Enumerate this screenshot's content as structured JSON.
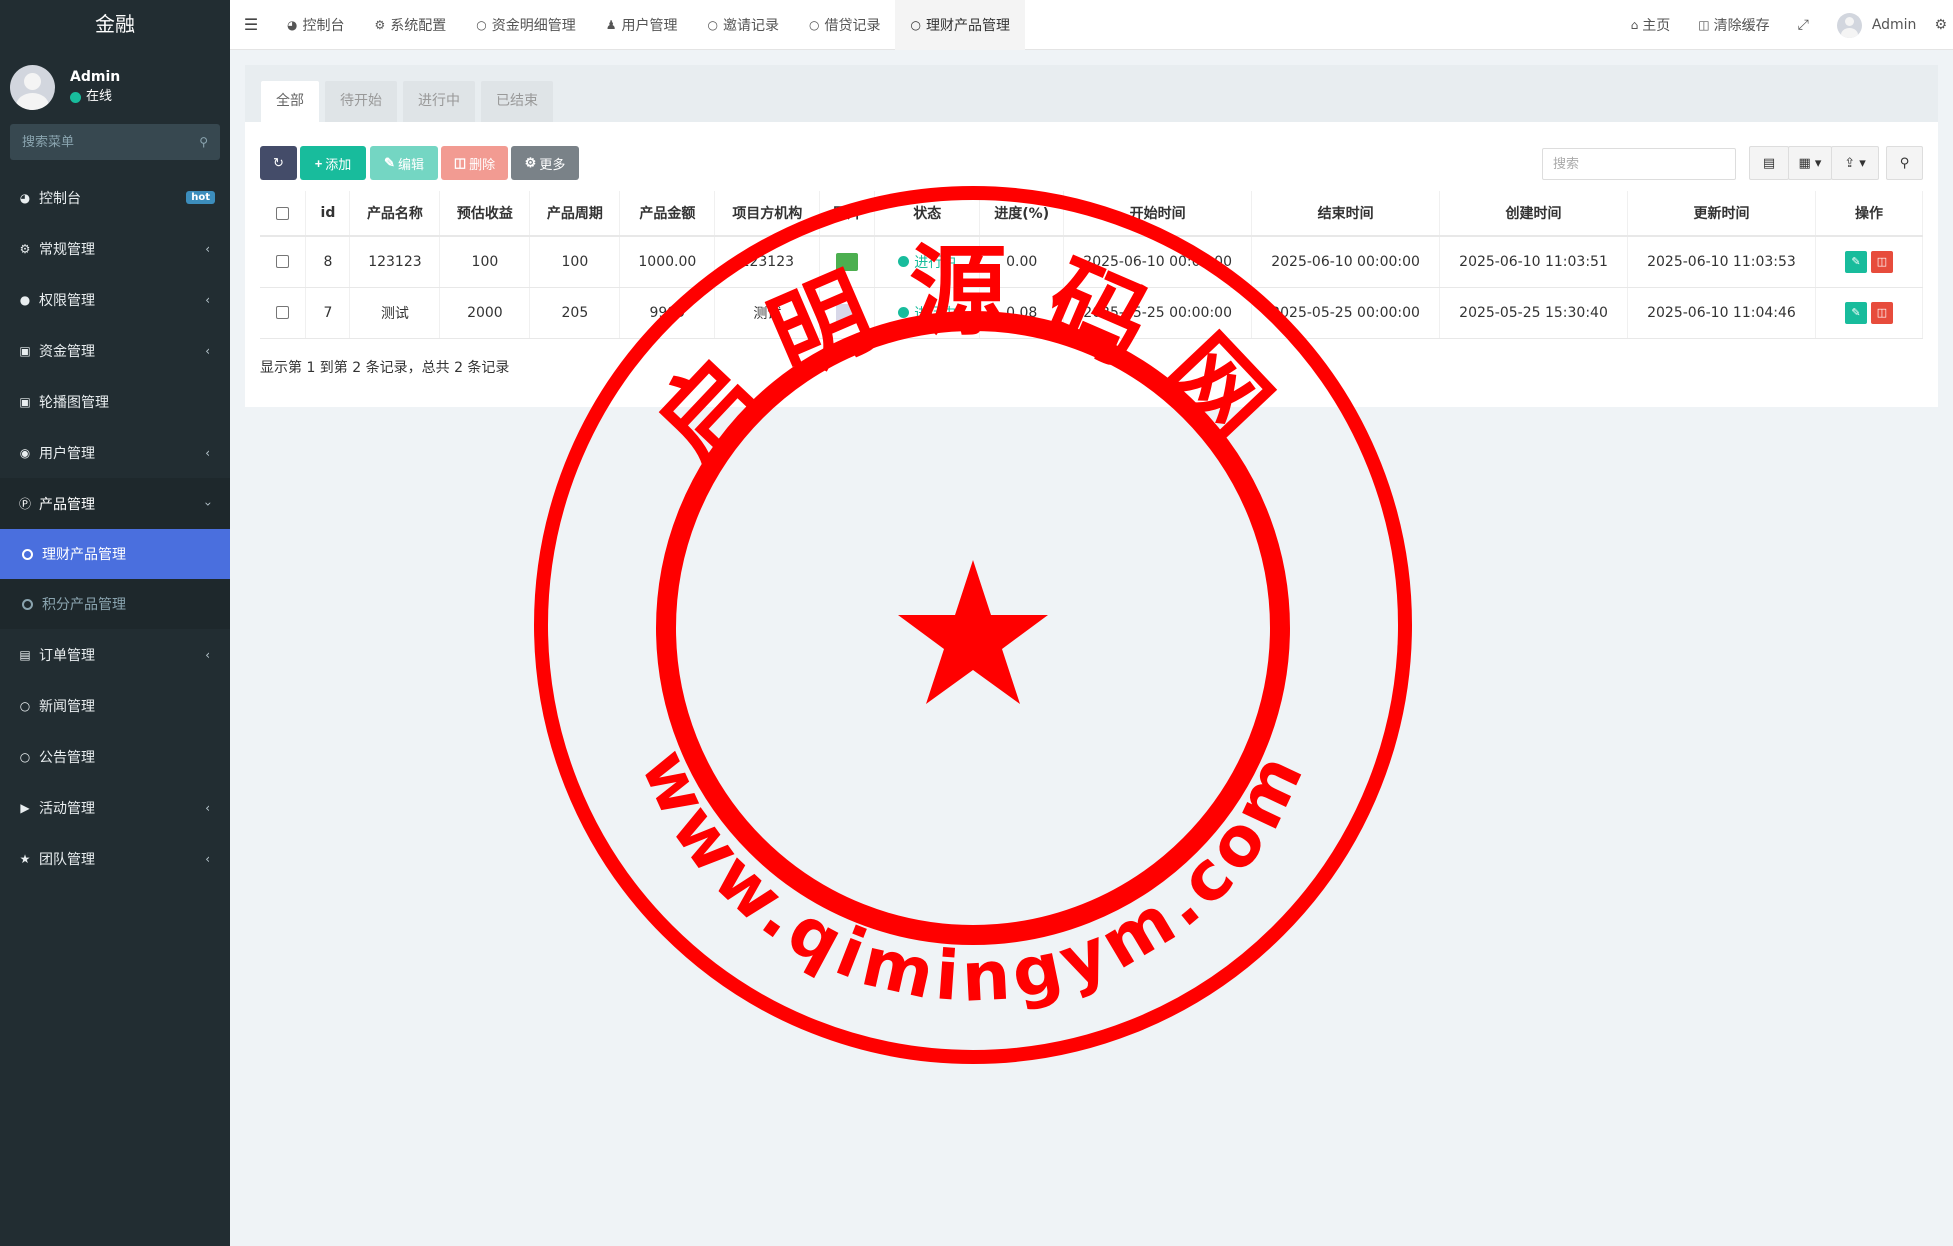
{
  "brand": "金融",
  "user": {
    "name": "Admin",
    "status": "在线"
  },
  "sidebar": {
    "search_placeholder": "搜索菜单",
    "items": [
      {
        "label": "控制台",
        "icon": "dashboard-icon",
        "badge": "hot"
      },
      {
        "label": "常规管理",
        "icon": "cogs-icon"
      },
      {
        "label": "权限管理",
        "icon": "group-icon"
      },
      {
        "label": "资金管理",
        "icon": "money-icon"
      },
      {
        "label": "轮播图管理",
        "icon": "image-icon"
      },
      {
        "label": "用户管理",
        "icon": "user-circle-icon"
      },
      {
        "label": "产品管理",
        "icon": "product-icon"
      },
      {
        "label": "订单管理",
        "icon": "list-icon"
      },
      {
        "label": "新闻管理",
        "icon": "circle-icon"
      },
      {
        "label": "公告管理",
        "icon": "circle-icon"
      },
      {
        "label": "活动管理",
        "icon": "play-circle-icon"
      },
      {
        "label": "团队管理",
        "icon": "trophy-icon"
      }
    ],
    "submenu": [
      {
        "label": "理财产品管理"
      },
      {
        "label": "积分产品管理"
      }
    ]
  },
  "navbar": {
    "tabs": [
      {
        "label": "控制台"
      },
      {
        "label": "系统配置"
      },
      {
        "label": "资金明细管理"
      },
      {
        "label": "用户管理"
      },
      {
        "label": "邀请记录"
      },
      {
        "label": "借贷记录"
      },
      {
        "label": "理财产品管理"
      }
    ],
    "home": "主页",
    "clear_cache": "清除缓存",
    "admin": "Admin"
  },
  "panel": {
    "tabs": [
      "全部",
      "待开始",
      "进行中",
      "已结束"
    ],
    "toolbar": {
      "add": "添加",
      "edit": "编辑",
      "delete": "删除",
      "more": "更多",
      "search_placeholder": "搜索"
    },
    "columns": [
      "id",
      "产品名称",
      "预估收益",
      "产品周期",
      "产品金额",
      "项目方机构",
      "图片",
      "状态",
      "进度(%)",
      "开始时间",
      "结束时间",
      "创建时间",
      "更新时间",
      "操作"
    ],
    "rows": [
      {
        "id": "8",
        "name": "123123",
        "income": "100",
        "period": "100",
        "amount": "1000.00",
        "org": "123123",
        "status": "进行中",
        "progress": "0.00",
        "start": "2025-06-10 00:00:00",
        "end": "2025-06-10 00:00:00",
        "created": "2025-06-10 11:03:51",
        "updated": "2025-06-10 11:03:53"
      },
      {
        "id": "7",
        "name": "测试",
        "income": "2000",
        "period": "205",
        "amount": "9999",
        "org": "测试",
        "status": "进行中",
        "progress": "0.08",
        "start": "2025-05-25 00:00:00",
        "end": "2025-05-25 00:00:00",
        "created": "2025-05-25 15:30:40",
        "updated": "2025-06-10 11:04:46"
      }
    ],
    "pager": "显示第 1 到第 2 条记录，总共 2 条记录"
  },
  "stamp": {
    "top_text": "启明源码网",
    "bottom_text": "www.qimingym.com"
  },
  "colors": {
    "sidebar_bg": "#222d32",
    "active_blue": "#4a6fde",
    "success": "#18bc9c",
    "danger": "#e74c3c",
    "stamp_red": "#ff0000"
  }
}
